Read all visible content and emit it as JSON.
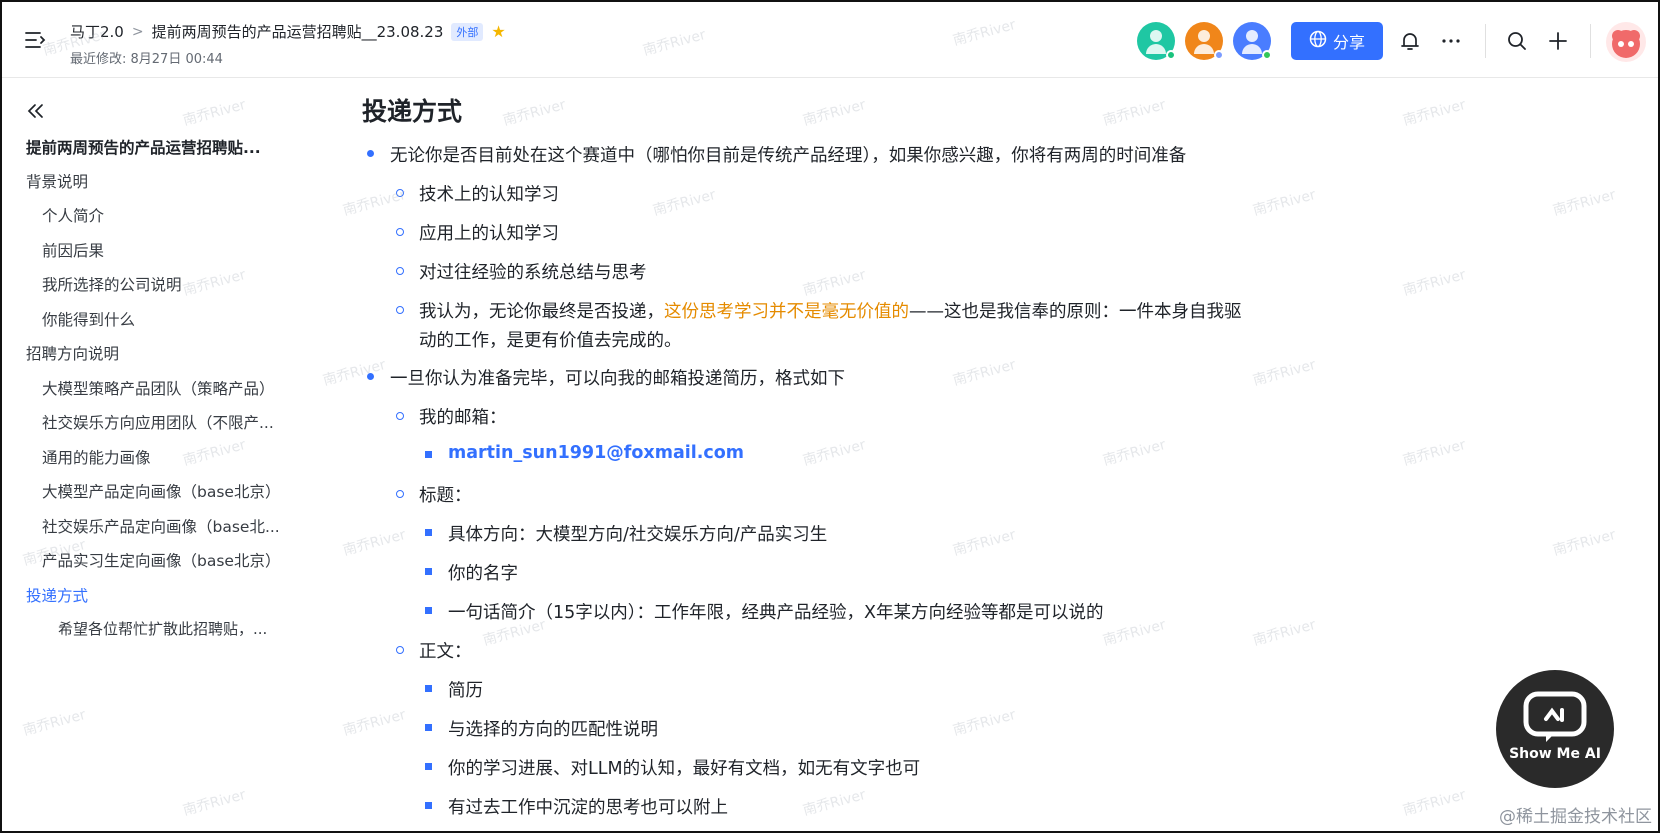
{
  "header": {
    "breadcrumb_root": "马丁2.0",
    "breadcrumb_sep": ">",
    "doc_title": "提前两周预告的产品运营招聘贴__23.08.23",
    "external_badge": "外部",
    "last_modified": "最近修改: 8月27日 00:44",
    "share_label": "分享",
    "avatars": [
      {
        "color": "#1fc7a3",
        "status": "#19c37d"
      },
      {
        "color": "#f0861a",
        "status": "#7b9cff"
      },
      {
        "color": "#4a7dff",
        "status": "#34c759"
      }
    ],
    "icons": [
      "menu-icon",
      "star-icon",
      "globe-icon",
      "bell-icon",
      "more-icon",
      "search-icon",
      "plus-icon"
    ]
  },
  "toc": {
    "items": [
      {
        "label": "提前两周预告的产品运营招聘贴...",
        "level": 0,
        "title": true
      },
      {
        "label": "背景说明",
        "level": 0
      },
      {
        "label": "个人简介",
        "level": 1
      },
      {
        "label": "前因后果",
        "level": 1
      },
      {
        "label": "我所选择的公司说明",
        "level": 1
      },
      {
        "label": "你能得到什么",
        "level": 1
      },
      {
        "label": "招聘方向说明",
        "level": 0
      },
      {
        "label": "大模型策略产品团队（策略产品）",
        "level": 1
      },
      {
        "label": "社交娱乐方向应用团队（不限产...",
        "level": 1
      },
      {
        "label": "通用的能力画像",
        "level": 1
      },
      {
        "label": "大模型产品定向画像（base北京）",
        "level": 1
      },
      {
        "label": "社交娱乐产品定向画像（base北...",
        "level": 1
      },
      {
        "label": "产品实习生定向画像（base北京）",
        "level": 1
      },
      {
        "label": "投递方式",
        "level": 0,
        "active": true
      },
      {
        "label": "希望各位帮忙扩散此招聘贴，...",
        "level": 2
      }
    ]
  },
  "content": {
    "heading": "投递方式",
    "blocks": [
      {
        "type": "dot",
        "text": "无论你是否目前处在这个赛道中（哪怕你目前是传统产品经理），如果你感兴趣，你将有两周的时间准备"
      },
      {
        "type": "ring",
        "text": "技术上的认知学习"
      },
      {
        "type": "ring",
        "text": "应用上的认知学习"
      },
      {
        "type": "ring",
        "text": "对过往经验的系统总结与思考"
      },
      {
        "type": "ring",
        "text_before": "我认为，无论你最终是否投递，",
        "text_highlight": "这份思考学习并不是毫无价值的",
        "text_after": "——这也是我信奉的原则：一件本身自我驱",
        "text_line2": "动的工作，是更有价值去完成的。"
      },
      {
        "type": "dot",
        "text": "一旦你认为准备完毕，可以向我的邮箱投递简历，格式如下"
      },
      {
        "type": "ring",
        "text": "我的邮箱："
      },
      {
        "type": "square",
        "text": "martin_sun1991@foxmail.com"
      },
      {
        "type": "ring",
        "text": "标题："
      },
      {
        "type": "square",
        "text": "具体方向：大模型方向/社交娱乐方向/产品实习生"
      },
      {
        "type": "square",
        "text": "你的名字"
      },
      {
        "type": "square",
        "text": "一句话简介（15字以内）：工作年限，经典产品经验，X年某方向经验等都是可以说的"
      },
      {
        "type": "ring",
        "text": "正文："
      },
      {
        "type": "square",
        "text": "简历"
      },
      {
        "type": "square",
        "text": "与选择的方向的匹配性说明"
      },
      {
        "type": "square",
        "text": "你的学习进展、对LLM的认知，最好有文档，如无有文字也可"
      },
      {
        "type": "square",
        "text": "有过去工作中沉淀的思考也可以附上"
      }
    ]
  },
  "bot": {
    "label": "Show Me AI"
  },
  "corner_mark": "@稀土掘金技术社区",
  "watermark": "南乔River",
  "colors": {
    "accent": "#3370ff",
    "highlight": "#e58b00"
  }
}
